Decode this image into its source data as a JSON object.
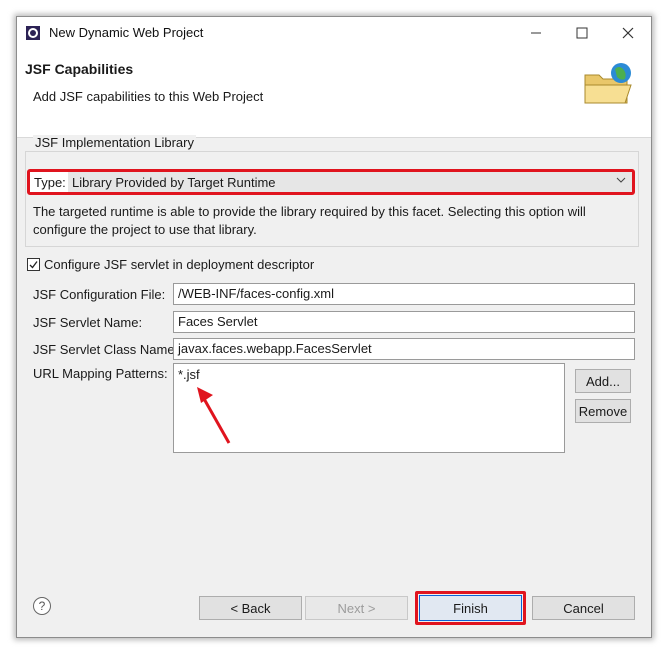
{
  "window": {
    "title": "New Dynamic Web Project",
    "minimize_icon": "minimize-icon",
    "maximize_icon": "maximize-icon",
    "close_icon": "close-icon"
  },
  "header": {
    "title": "JSF Capabilities",
    "subtitle": "Add JSF capabilities to this Web Project",
    "icon": "wizard-folder-globe-icon"
  },
  "implementation": {
    "group_label": "JSF Implementation Library",
    "type_label": "Type:",
    "type_value": "Library Provided by Target Runtime",
    "description": "The targeted runtime is able to provide the library required by this facet. Selecting this option will configure the project to use that library."
  },
  "servlet": {
    "configure_label": "Configure JSF servlet in deployment descriptor",
    "configure_checked": true,
    "config_file_label": "JSF Configuration File:",
    "config_file_value": "/WEB-INF/faces-config.xml",
    "servlet_name_label": "JSF Servlet Name:",
    "servlet_name_value": "Faces Servlet",
    "servlet_class_label": "JSF Servlet Class Name:",
    "servlet_class_value": "javax.faces.webapp.FacesServlet",
    "url_label": "URL Mapping Patterns:",
    "url_patterns": [
      "*.jsf"
    ],
    "add_label": "Add...",
    "remove_label": "Remove"
  },
  "footer": {
    "help_icon": "help-icon",
    "back_label": "< Back",
    "next_label": "Next >",
    "finish_label": "Finish",
    "cancel_label": "Cancel"
  },
  "colors": {
    "highlight": "#e0141e",
    "dialog_bg": "#f0f0f0",
    "focus_border": "#0b62d6"
  }
}
